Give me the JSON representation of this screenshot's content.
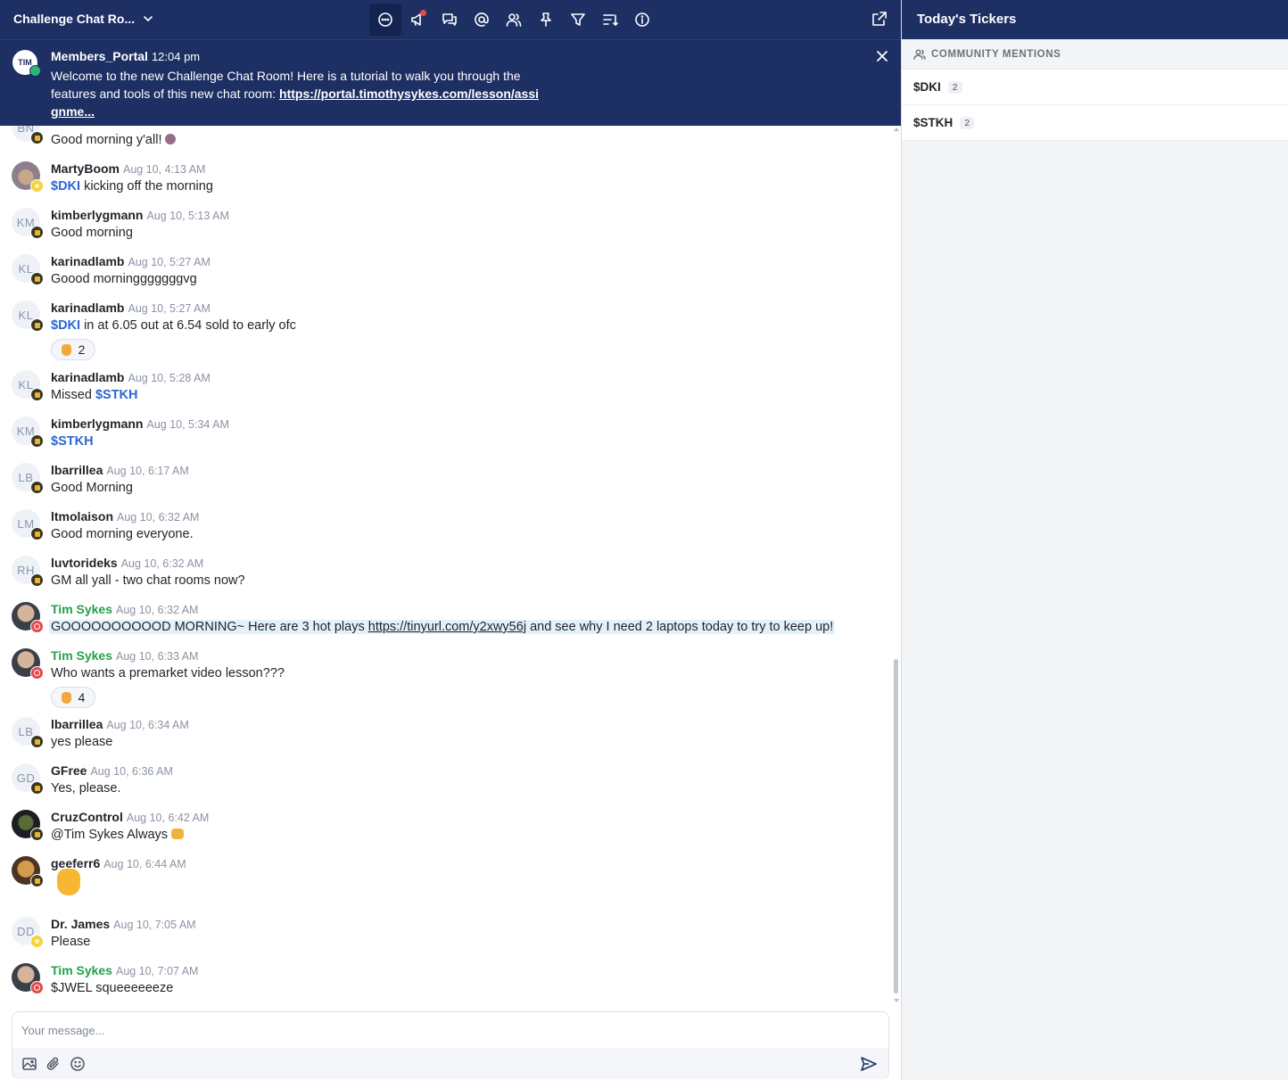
{
  "header": {
    "room_title": "Challenge Chat Ro...",
    "toolbar": [
      {
        "icon": "chat-bubble-icon",
        "active": true
      },
      {
        "icon": "megaphone-icon",
        "notification": true
      },
      {
        "icon": "threads-icon"
      },
      {
        "icon": "at-mention-icon"
      },
      {
        "icon": "members-icon"
      },
      {
        "icon": "pin-icon"
      },
      {
        "icon": "filter-icon"
      },
      {
        "icon": "sort-icon"
      },
      {
        "icon": "info-icon"
      }
    ]
  },
  "announcement": {
    "avatar_text": "TIM",
    "name": "Members_Portal",
    "time": "12:04 pm",
    "text": "Welcome to the new Challenge Chat Room! Here is a tutorial to walk you through the features and tools of this new chat room: ",
    "link_part1": "https://portal.timothysykes.com/lesson/assi",
    "link_part2": "gnme..."
  },
  "messages": [
    {
      "initials": "BN",
      "name": "",
      "time": "",
      "text": "Good morning y'all!",
      "rank": "gold"
    },
    {
      "initials": "",
      "name": "MartyBoom",
      "time": "Aug 10, 4:13 AM",
      "ticker": "$DKI",
      "text": " kicking off the morning",
      "rank": "lime"
    },
    {
      "initials": "KM",
      "name": "kimberlygmann",
      "time": "Aug 10, 5:13 AM",
      "text": "Good morning",
      "rank": "gold"
    },
    {
      "initials": "KL",
      "name": "karinadlamb",
      "time": "Aug 10, 5:27 AM",
      "text": "Goood morningggggggvg",
      "rank": "gold"
    },
    {
      "initials": "KL",
      "name": "karinadlamb",
      "time": "Aug 10, 5:27 AM",
      "ticker": "$DKI",
      "text": " in at 6.05 out at 6.54 sold to early ofc",
      "reaction_count": "2",
      "rank": "gold"
    },
    {
      "initials": "KL",
      "name": "karinadlamb",
      "time": "Aug 10, 5:28 AM",
      "text": "Missed ",
      "ticker_after": "$STKH",
      "rank": "gold"
    },
    {
      "initials": "KM",
      "name": "kimberlygmann",
      "time": "Aug 10, 5:34 AM",
      "ticker": "$STKH",
      "text": "",
      "rank": "gold"
    },
    {
      "initials": "LB",
      "name": "lbarrillea",
      "time": "Aug 10, 6:17 AM",
      "text": "Good Morning",
      "rank": "gold"
    },
    {
      "initials": "LM",
      "name": "ltmolaison",
      "time": "Aug 10, 6:32 AM",
      "text": "Good morning everyone.",
      "rank": "gold"
    },
    {
      "initials": "RH",
      "name": "luvtorideks",
      "time": "Aug 10, 6:32 AM",
      "text": "GM all yall - two chat rooms now?",
      "rank": "gold"
    },
    {
      "initials": "",
      "name": "Tim Sykes",
      "time": "Aug 10, 6:32 AM",
      "text": "GOOOOOOOOOOD MORNING~ Here are 3 hot plays ",
      "link": "https://tinyurl.com/y2xwy56j",
      "text_after": " and see why I need 2 laptops today to try to keep up!",
      "rank": "red"
    },
    {
      "initials": "",
      "name": "Tim Sykes",
      "time": "Aug 10, 6:33 AM",
      "text": "Who wants a premarket video lesson???",
      "reaction_count": "4",
      "rank": "red"
    },
    {
      "initials": "LB",
      "name": "lbarrillea",
      "time": "Aug 10, 6:34 AM",
      "text": "yes please",
      "rank": "gold"
    },
    {
      "initials": "GD",
      "name": "GFree",
      "time": "Aug 10, 6:36 AM",
      "text": "Yes, please.",
      "rank": "gold"
    },
    {
      "initials": "",
      "name": "CruzControl",
      "time": "Aug 10, 6:42 AM",
      "text": "@Tim Sykes Always",
      "rank": "gold"
    },
    {
      "initials": "",
      "name": "geeferr6",
      "time": "Aug 10, 6:44 AM",
      "text": "",
      "rank": "gold"
    },
    {
      "initials": "DD",
      "name": "Dr. James",
      "time": "Aug 10, 7:05 AM",
      "text": "Please",
      "rank": "yellow"
    },
    {
      "initials": "",
      "name": "Tim Sykes",
      "time": "Aug 10, 7:07 AM",
      "text": "$JWEL squeeeeeeze",
      "rank": "red"
    }
  ],
  "composer": {
    "placeholder": "Your message..."
  },
  "tickers": {
    "title": "Today's Tickers",
    "section": "COMMUNITY MENTIONS",
    "items": [
      {
        "symbol": "$DKI",
        "count": "2"
      },
      {
        "symbol": "$STKH",
        "count": "2"
      }
    ]
  }
}
